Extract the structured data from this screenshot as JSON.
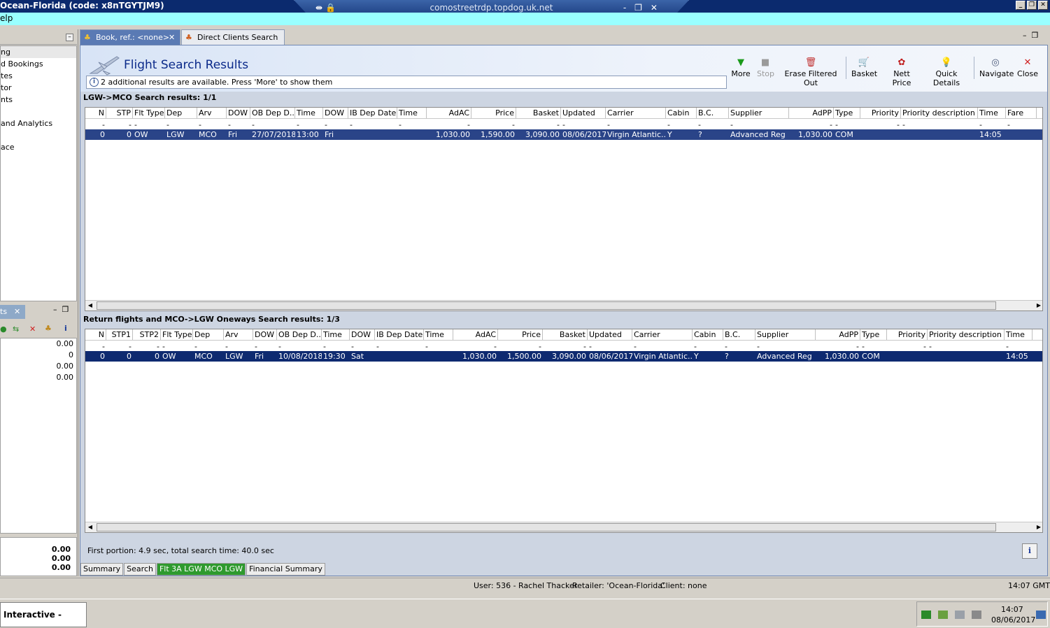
{
  "window": {
    "title": "Ocean-Florida (code: x8nTGYTJM9)",
    "rdp_host": "comostreetrdp.topdog.uk.net"
  },
  "menu": {
    "visible_item": "elp"
  },
  "left_panel": {
    "items": [
      "ng",
      "d Bookings",
      "tes",
      "tor",
      "nts",
      "",
      "and Analytics",
      "",
      "ace"
    ],
    "tab_label": "ts",
    "values": [
      "0.00",
      "0",
      "0.00",
      "0.00"
    ],
    "totals": [
      "0.00",
      "0.00",
      "0.00"
    ]
  },
  "tabs": [
    {
      "label": "Book, ref.: <none>",
      "active": true
    },
    {
      "label": "Direct Clients Search",
      "active": false
    }
  ],
  "header": {
    "title": "Flight Search Results",
    "info": "2 additional results are available. Press 'More' to show them"
  },
  "toolbar": [
    {
      "label": "More",
      "icon": "triangle-down-icon",
      "color": "#1a9a1a"
    },
    {
      "label": "Stop",
      "icon": "stop-icon",
      "color": "#9a9a9a"
    },
    {
      "label": "Erase Filtered Out",
      "icon": "erase-icon",
      "color": "#c03030"
    },
    {
      "label": "Basket",
      "icon": "basket-icon",
      "color": "#707070"
    },
    {
      "label": "Nett Price",
      "icon": "nett-price-icon",
      "color": "#c02020"
    },
    {
      "label": "Quick Details",
      "icon": "lightbulb-icon",
      "color": "#e0c020"
    },
    {
      "label": "Navigate",
      "icon": "navigate-icon",
      "color": "#4a5a7a"
    },
    {
      "label": "Close",
      "icon": "close-icon",
      "color": "#d02020"
    }
  ],
  "outbound": {
    "title": "LGW->MCO Search results: 1/1",
    "columns": [
      "N",
      "STP",
      "Flt Type",
      "Dep",
      "Arv",
      "DOW",
      "OB Dep D...",
      "Time",
      "DOW",
      "IB Dep Date",
      "Time",
      "AdAC",
      "Price",
      "Basket",
      "Updated",
      "Carrier",
      "Cabin",
      "B.C.",
      "Supplier",
      "AdPP",
      "Type",
      "Priority",
      "Priority description",
      "Time",
      "Fare"
    ],
    "filter": [
      "-",
      "-",
      "-",
      "-",
      "-",
      "-",
      "-",
      "-",
      "-",
      "-",
      "-",
      "-",
      "-",
      "-",
      "-",
      "-",
      "-",
      "-",
      "-",
      "-",
      "-",
      "-",
      "-",
      "-",
      "-"
    ],
    "row": [
      "0",
      "0",
      "OW",
      "LGW",
      "MCO",
      "Fri",
      "27/07/2018",
      "13:00",
      "Fri",
      "",
      "",
      "1,030.00",
      "1,590.00",
      "3,090.00",
      "08/06/2017",
      "Virgin Atlantic...",
      "Y",
      "?",
      "Advanced Reg",
      "1,030.00",
      "COM",
      "",
      "",
      "14:05",
      ""
    ]
  },
  "return": {
    "title": "Return flights and MCO->LGW Oneways Search results: 1/3",
    "columns": [
      "N",
      "STP1",
      "STP2",
      "Flt Type",
      "Dep",
      "Arv",
      "DOW",
      "OB Dep D...",
      "Time",
      "DOW",
      "IB Dep Date",
      "Time",
      "AdAC",
      "Price",
      "Basket",
      "Updated",
      "Carrier",
      "Cabin",
      "B.C.",
      "Supplier",
      "AdPP",
      "Type",
      "Priority",
      "Priority description",
      "Time"
    ],
    "filter": [
      "-",
      "-",
      "-",
      "-",
      "-",
      "-",
      "-",
      "-",
      "-",
      "-",
      "-",
      "-",
      "-",
      "-",
      "-",
      "-",
      "-",
      "-",
      "-",
      "-",
      "-",
      "-",
      "-",
      "-",
      "-"
    ],
    "row": [
      "0",
      "0",
      "0",
      "OW",
      "MCO",
      "LGW",
      "Fri",
      "10/08/2018",
      "19:30",
      "Sat",
      "",
      "",
      "1,030.00",
      "1,500.00",
      "3,090.00",
      "08/06/2017",
      "Virgin Atlantic...",
      "Y",
      "?",
      "Advanced Reg",
      "1,030.00",
      "COM",
      "",
      "",
      "14:05"
    ]
  },
  "search_time": "First portion: 4.9 sec, total search time: 40.0 sec",
  "bottom_tabs": [
    {
      "label": "Summary",
      "active": false
    },
    {
      "label": "Search",
      "active": false
    },
    {
      "label": "Flt 3A LGW MCO LGW",
      "active": true
    },
    {
      "label": "Financial Summary",
      "active": false
    }
  ],
  "statusbar": {
    "user": "User: 536 - Rachel Thacker",
    "retailer": "Retailer: 'Ocean-Florida'",
    "client": "Client: none",
    "time": "14:07 GMT"
  },
  "taskbar": {
    "item": "Interactive - Ocea...",
    "clock_time": "14:07",
    "clock_date": "08/06/2017"
  }
}
